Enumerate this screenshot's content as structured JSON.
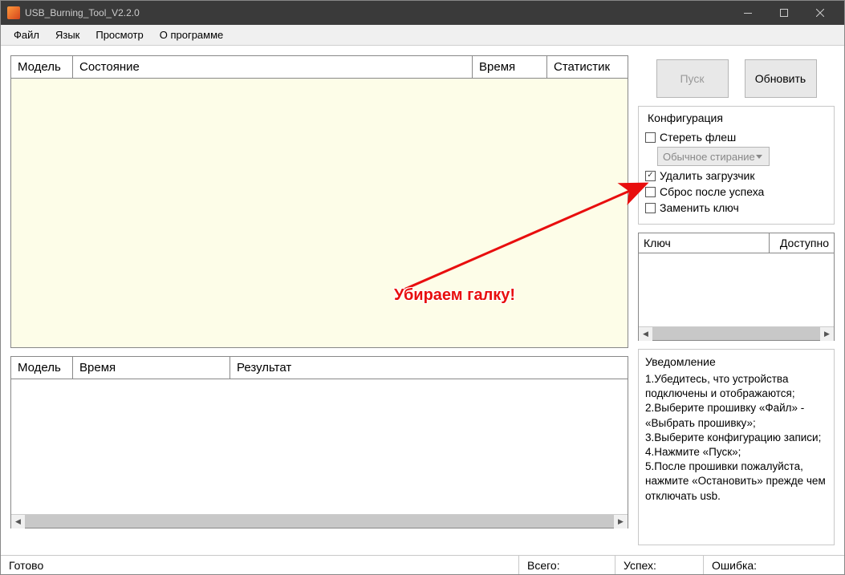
{
  "window": {
    "title": "USB_Burning_Tool_V2.2.0"
  },
  "menu": {
    "file": "Файл",
    "lang": "Язык",
    "view": "Просмотр",
    "about": "О программе"
  },
  "main_table": {
    "model": "Модель",
    "state": "Состояние",
    "time": "Время",
    "stat": "Статистик"
  },
  "result_table": {
    "model": "Модель",
    "time": "Время",
    "result": "Результат"
  },
  "buttons": {
    "start": "Пуск",
    "refresh": "Обновить"
  },
  "config": {
    "title": "Конфигурация",
    "erase_flash": "Стереть флеш",
    "erase_mode": "Обычное стирание",
    "erase_bootloader": "Удалить загрузчик",
    "reset_after": "Сброс после успеха",
    "replace_key": "Заменить ключ"
  },
  "key_table": {
    "key": "Ключ",
    "avail": "Доступно"
  },
  "notify": {
    "title": "Уведомление",
    "l1": "1.Убедитесь, что устройства подключены и отображаются;",
    "l2": "2.Выберите прошивку «Файл» - «Выбрать прошивку»;",
    "l3": "3.Выберите конфигурацию записи;",
    "l4": "4.Нажмите «Пуск»;",
    "l5": "5.После прошивки пожалуйста, нажмите «Остановить» прежде чем отключать usb."
  },
  "status": {
    "ready": "Готово",
    "total": "Всего:",
    "success": "Успех:",
    "error": "Ошибка:"
  },
  "annotation": {
    "text": "Убираем галку!"
  }
}
